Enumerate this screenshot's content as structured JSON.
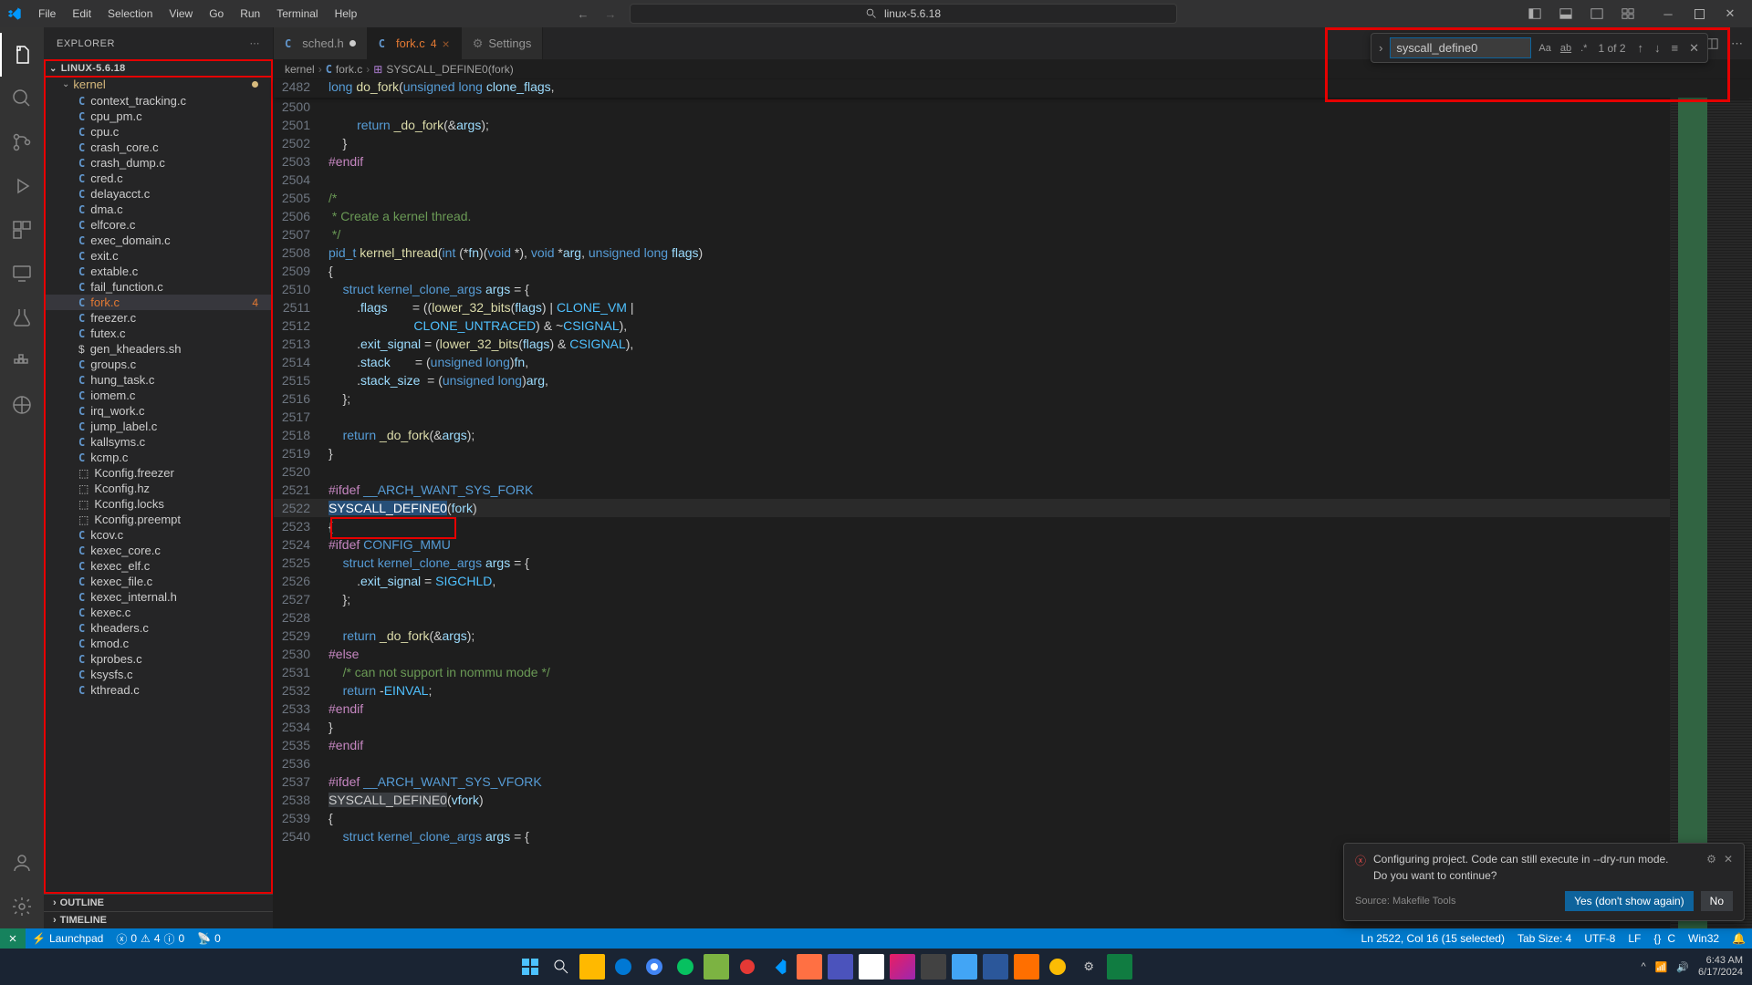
{
  "menu": [
    "File",
    "Edit",
    "Selection",
    "View",
    "Go",
    "Run",
    "Terminal",
    "Help"
  ],
  "title_center": "linux-5.6.18",
  "sidebar": {
    "title": "EXPLORER",
    "project": "LINUX-5.6.18",
    "folder_highlighted": "kernel",
    "files_top": [
      "context_tracking.c",
      "cpu_pm.c",
      "cpu.c",
      "crash_core.c",
      "crash_dump.c",
      "cred.c",
      "delayacct.c",
      "dma.c",
      "elfcore.c",
      "exec_domain.c",
      "exit.c",
      "extable.c",
      "fail_function.c"
    ],
    "active_file": "fork.c",
    "active_file_badge": "4",
    "files_bottom": [
      "freezer.c",
      "futex.c",
      "gen_kheaders.sh",
      "groups.c",
      "hung_task.c",
      "iomem.c",
      "irq_work.c",
      "jump_label.c",
      "kallsyms.c",
      "kcmp.c",
      "Kconfig.freezer",
      "Kconfig.hz",
      "Kconfig.locks",
      "Kconfig.preempt",
      "kcov.c",
      "kexec_core.c",
      "kexec_elf.c",
      "kexec_file.c",
      "kexec_internal.h",
      "kexec.c",
      "kheaders.c",
      "kmod.c",
      "kprobes.c",
      "ksysfs.c",
      "kthread.c"
    ],
    "outline": "OUTLINE",
    "timeline": "TIMELINE"
  },
  "tabs": [
    {
      "icon": "C",
      "label": "sched.h",
      "modified": true
    },
    {
      "icon": "C",
      "label": "fork.c",
      "num": "4",
      "active": true,
      "close": true
    },
    {
      "icon": "gear",
      "label": "Settings"
    }
  ],
  "breadcrumb": [
    "kernel",
    "fork.c",
    "SYSCALL_DEFINE0(fork)"
  ],
  "sticky": {
    "ln": "2482"
  },
  "find": {
    "value": "syscall_define0",
    "count": "1 of 2"
  },
  "code_start": 2500,
  "notification": {
    "text1": "Configuring project. Code can still execute in --dry-run mode.",
    "text2": "Do you want to continue?",
    "source": "Source: Makefile Tools",
    "btn_yes": "Yes (don't show again)",
    "btn_no": "No"
  },
  "status": {
    "launchpad": "Launchpad",
    "errors": "0",
    "warnings": "4",
    "hints": "0",
    "ports": "0",
    "cursor": "Ln 2522, Col 16 (15 selected)",
    "tab": "Tab Size: 4",
    "enc": "UTF-8",
    "eol": "LF",
    "lang": "C",
    "os": "Win32"
  },
  "clock": {
    "time": "6:43 AM",
    "date": "6/17/2024"
  }
}
